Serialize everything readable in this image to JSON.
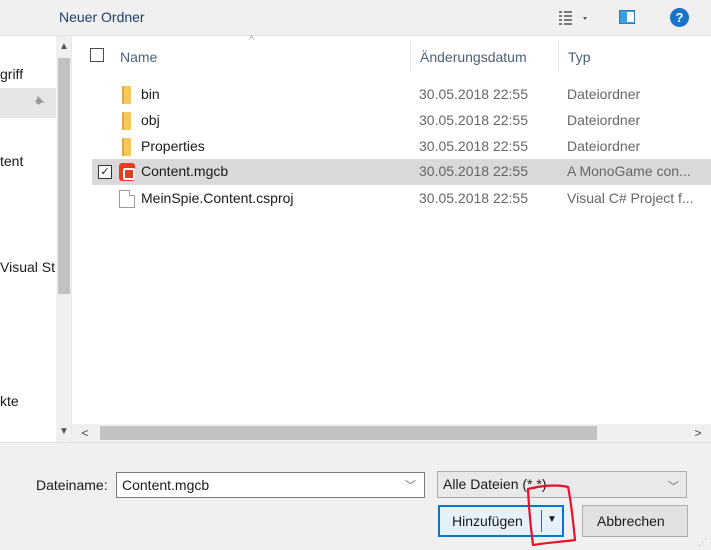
{
  "toolbar": {
    "new_folder_label": "Neuer Ordner",
    "help_label": "?"
  },
  "nav": {
    "items": [
      {
        "label": "griff"
      },
      {
        "label": "tent"
      },
      {
        "label": "Visual St"
      },
      {
        "label": "kte"
      }
    ]
  },
  "list": {
    "columns": {
      "name": "Name",
      "date": "Änderungsdatum",
      "type": "Typ"
    },
    "rows": [
      {
        "name": "bin",
        "date": "30.05.2018 22:55",
        "type": "Dateiordner",
        "icon": "folder-icon",
        "selected": false
      },
      {
        "name": "obj",
        "date": "30.05.2018 22:55",
        "type": "Dateiordner",
        "icon": "folder-icon",
        "selected": false
      },
      {
        "name": "Properties",
        "date": "30.05.2018 22:55",
        "type": "Dateiordner",
        "icon": "folder-icon",
        "selected": false
      },
      {
        "name": "Content.mgcb",
        "date": "30.05.2018 22:55",
        "type": "A MonoGame con...",
        "icon": "monogame-icon",
        "selected": true
      },
      {
        "name": "MeinSpie.Content.csproj",
        "date": "30.05.2018 22:55",
        "type": "Visual C# Project f...",
        "icon": "document-icon",
        "selected": false
      }
    ]
  },
  "footer": {
    "filename_label": "Dateiname:",
    "filename_value": "Content.mgcb",
    "filter_value": "Alle Dateien (*.*)",
    "add_label": "Hinzufügen",
    "cancel_label": "Abbrechen"
  },
  "colors": {
    "accent": "#0078d7",
    "annotation": "#e8102a",
    "selected_row": "#d9d9d9"
  }
}
